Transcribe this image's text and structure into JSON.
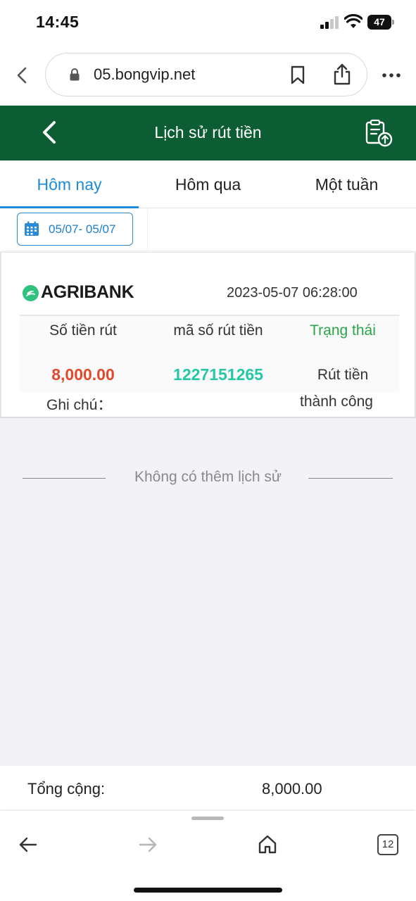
{
  "status_bar": {
    "time": "14:45",
    "battery": "47"
  },
  "browser": {
    "url": "05.bongvip.net",
    "tab_count": "12"
  },
  "header": {
    "title": "Lịch sử rút tiền"
  },
  "tabs": [
    {
      "label": "Hôm nay",
      "active": true
    },
    {
      "label": "Hôm qua",
      "active": false
    },
    {
      "label": "Một tuần",
      "active": false
    }
  ],
  "date_filter": {
    "range": "05/07- 05/07"
  },
  "record": {
    "bank": "AGRIBANK",
    "time": "2023-05-07 06:28:00",
    "columns": [
      "Số tiền rút",
      "mã số rút tiền",
      "Trạng thái"
    ],
    "amount": "8,000.00",
    "code": "1227151265",
    "status_line1": "Rút tiền",
    "status_line2": "thành công",
    "note_label": "Ghi chú："
  },
  "end_message": "Không có thêm lịch sử",
  "totals": {
    "label": "Tổng cộng:",
    "value": "8,000.00"
  },
  "colors": {
    "header_green": "#0c5d33",
    "active_tab": "#1e8bd8",
    "amount_red": "#e0492b",
    "code_teal": "#26c7a6",
    "status_green": "#2aa54a"
  }
}
